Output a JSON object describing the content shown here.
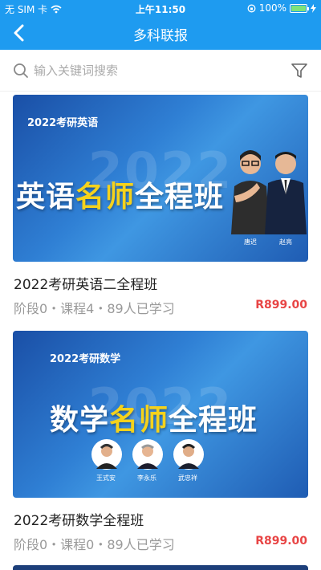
{
  "status_bar": {
    "carrier": "无 SIM 卡",
    "time": "上午11:50",
    "battery": "100%",
    "battery_level": 1.0
  },
  "nav": {
    "back_icon": "chevron-left-icon",
    "title": "多科联报"
  },
  "search": {
    "placeholder": "输入关键词搜索",
    "value": "",
    "search_icon": "search-icon",
    "filter_icon": "filter-icon"
  },
  "courses": [
    {
      "banner_tag": "2022考研英语",
      "banner_year": "2022",
      "banner_headline_a": "英语",
      "banner_headline_b": "名师",
      "banner_headline_c": "全程班",
      "teachers": [
        "唐迟",
        "赵亮"
      ],
      "title": "2022考研英语二全程班",
      "meta": "阶段0・课程4・89人已学习",
      "price": "R899.00"
    },
    {
      "banner_tag": "2022考研数学",
      "banner_year": "2022",
      "banner_headline_a": "数学",
      "banner_headline_b": "名师",
      "banner_headline_c": "全程班",
      "teachers": [
        "王式安",
        "李永乐",
        "武忠祥"
      ],
      "title": "2022考研数学全程班",
      "meta": "阶段0・课程0・89人已学习",
      "price": "R899.00"
    }
  ],
  "colors": {
    "primary": "#1e9bf0",
    "price": "#e84545",
    "highlight": "#f5d21c"
  }
}
